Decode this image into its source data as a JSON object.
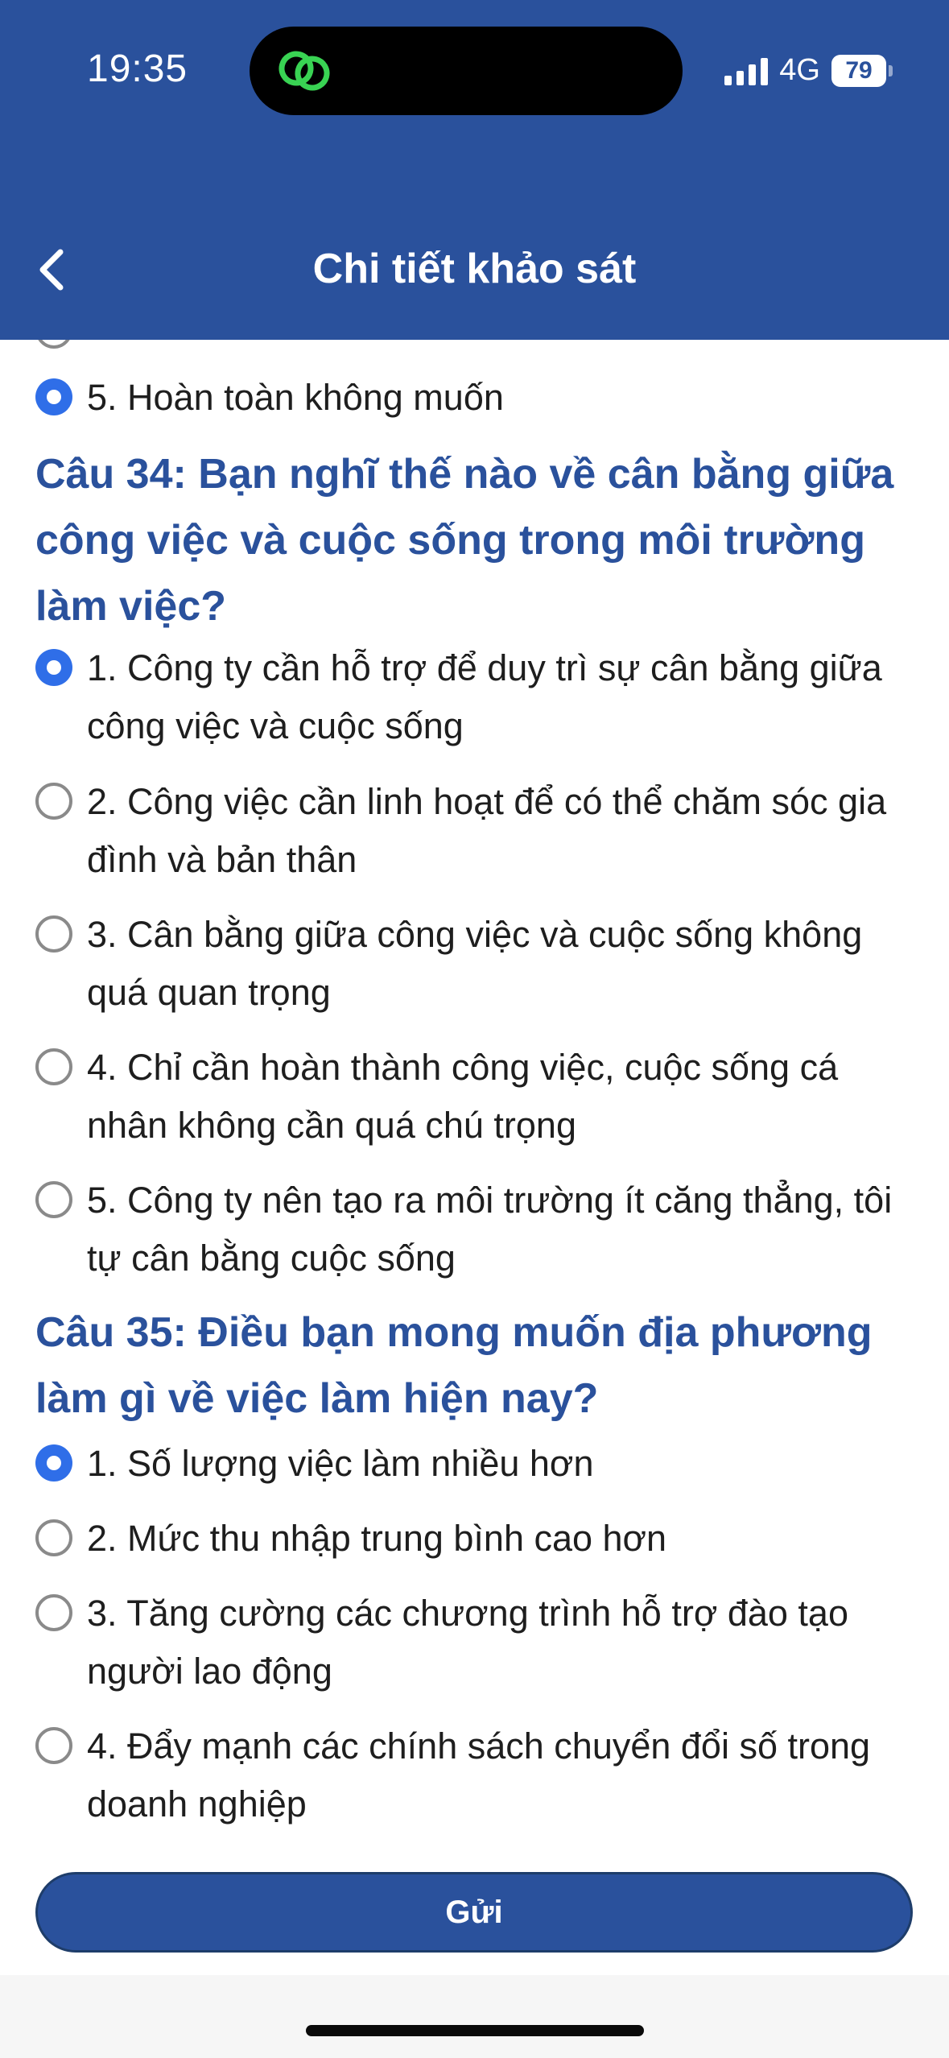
{
  "status_bar": {
    "time": "19:35",
    "network": "4G",
    "battery": "79"
  },
  "header": {
    "title": "Chi tiết khảo sát"
  },
  "partial_option": {
    "text": "5. Hoàn toàn không muốn",
    "checked": true
  },
  "questions": [
    {
      "title": "Câu 34: Bạn nghĩ thế nào về cân bằng giữa công việc và cuộc sống trong môi trường làm việc?",
      "options": [
        {
          "text": "1. Công ty cần hỗ trợ để duy trì sự cân bằng giữa công việc và cuộc sống",
          "checked": true
        },
        {
          "text": "2. Công việc cần linh hoạt để có thể chăm sóc gia đình và bản thân",
          "checked": false
        },
        {
          "text": "3. Cân bằng giữa công việc và cuộc sống không quá quan trọng",
          "checked": false
        },
        {
          "text": "4. Chỉ cần hoàn thành công việc, cuộc sống cá nhân không cần quá chú trọng",
          "checked": false
        },
        {
          "text": "5. Công ty nên tạo ra môi trường ít căng thẳng, tôi tự cân bằng cuộc sống",
          "checked": false
        }
      ]
    },
    {
      "title": "Câu 35: Điều bạn mong muốn địa phương làm gì về việc làm hiện nay?",
      "options": [
        {
          "text": "1. Số lượng việc làm nhiều hơn",
          "checked": true
        },
        {
          "text": "2. Mức thu nhập trung bình cao hơn",
          "checked": false
        },
        {
          "text": "3. Tăng cường các chương trình hỗ trợ đào tạo người lao động",
          "checked": false
        },
        {
          "text": "4. Đẩy mạnh các chính sách chuyển đổi số trong doanh nghiệp",
          "checked": false
        }
      ]
    }
  ],
  "submit_label": "Gửi",
  "colors": {
    "header": "#2a519c",
    "question": "#2a519c",
    "radio_checked": "#2f6ee8",
    "island_icon": "#39d353"
  }
}
